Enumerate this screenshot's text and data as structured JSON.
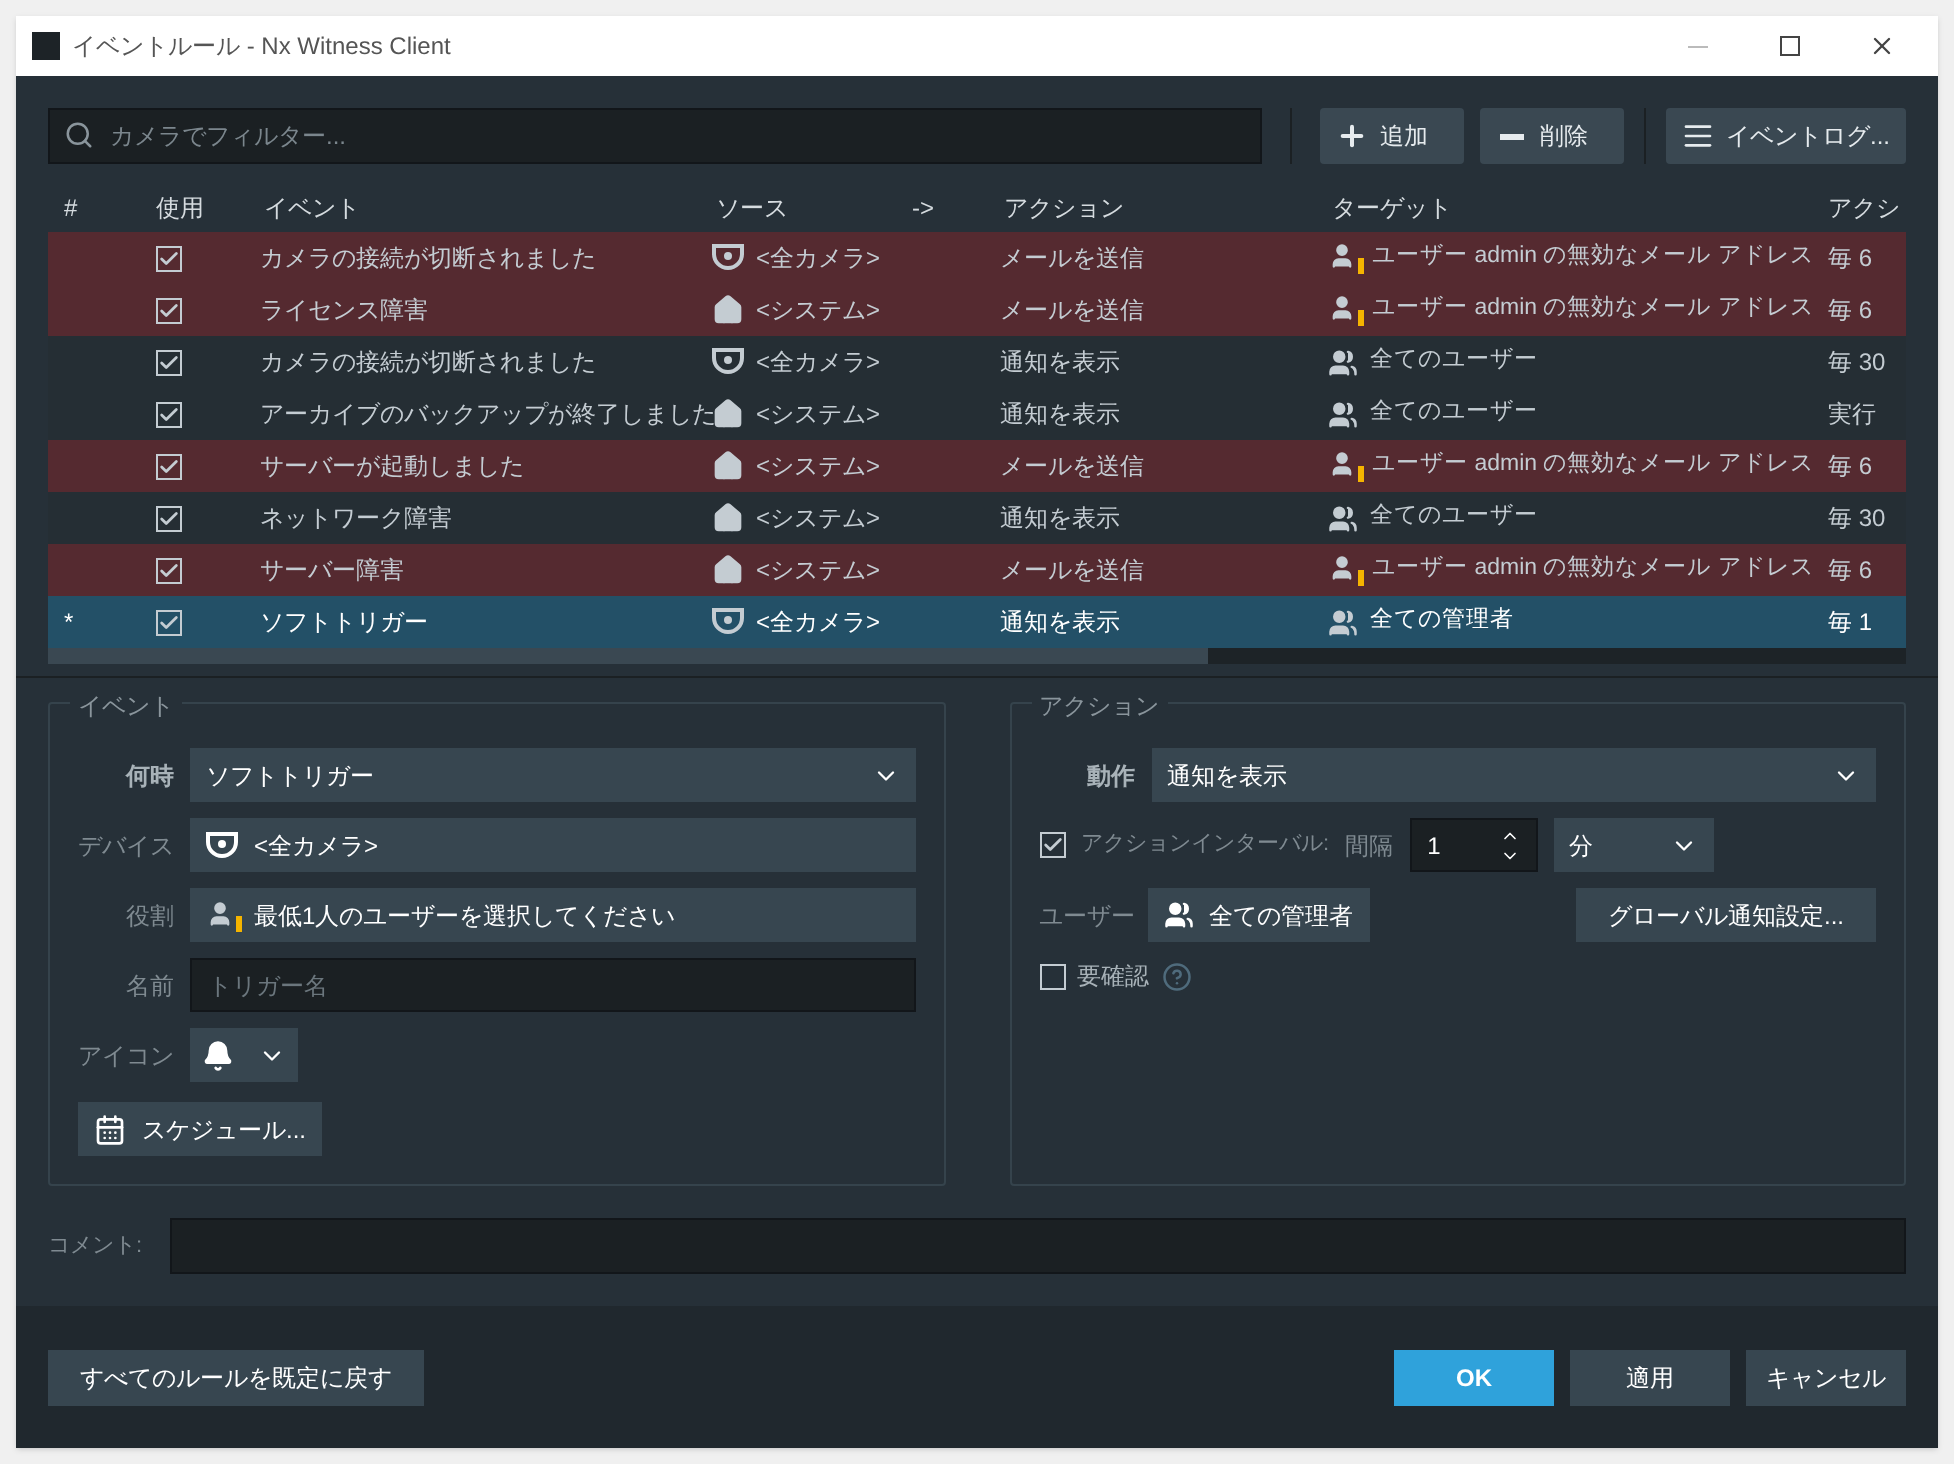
{
  "window": {
    "title": "イベントルール - Nx Witness Client"
  },
  "toolbar": {
    "search": {
      "placeholder": "カメラでフィルター..."
    },
    "buttons": [
      {
        "kind": "add",
        "label": "追加"
      },
      {
        "kind": "remove",
        "label": "削除"
      },
      {
        "kind": "log",
        "label": "イベントログ..."
      }
    ]
  },
  "table": {
    "columns": [
      "#",
      "使用",
      "イベント",
      "ソース",
      "->",
      "アクション",
      "ターゲット",
      "アクシ"
    ],
    "rows": [
      {
        "marker": "",
        "enabled": true,
        "invalid": true,
        "selected": false,
        "event": "カメラの接続が切断されました",
        "source": {
          "kind": "camera",
          "label": "<全カメラ>"
        },
        "action": "メールを送信",
        "target": {
          "kind": "user-warning",
          "label": "ユーザー admin の無効なメール アドレス"
        },
        "column_8": "毎 6"
      },
      {
        "marker": "",
        "enabled": true,
        "invalid": true,
        "selected": false,
        "event": "ライセンス障害",
        "source": {
          "kind": "system",
          "label": "<システム>"
        },
        "action": "メールを送信",
        "target": {
          "kind": "user-warning",
          "label": "ユーザー admin の無効なメール アドレス"
        },
        "column_8": "毎 6"
      },
      {
        "marker": "",
        "enabled": true,
        "invalid": false,
        "selected": false,
        "event": "カメラの接続が切断されました",
        "source": {
          "kind": "camera",
          "label": "<全カメラ>"
        },
        "action": "通知を表示",
        "target": {
          "kind": "users",
          "label": "全てのユーザー"
        },
        "column_8": "毎 30"
      },
      {
        "marker": "",
        "enabled": true,
        "invalid": false,
        "selected": false,
        "event": "アーカイブのバックアップが終了しました",
        "source": {
          "kind": "system",
          "label": "<システム>"
        },
        "action": "通知を表示",
        "target": {
          "kind": "users",
          "label": "全てのユーザー"
        },
        "column_8": "実行"
      },
      {
        "marker": "",
        "enabled": true,
        "invalid": true,
        "selected": false,
        "event": "サーバーが起動しました",
        "source": {
          "kind": "system",
          "label": "<システム>"
        },
        "action": "メールを送信",
        "target": {
          "kind": "user-warning",
          "label": "ユーザー admin の無効なメール アドレス"
        },
        "column_8": "毎 6"
      },
      {
        "marker": "",
        "enabled": true,
        "invalid": false,
        "selected": false,
        "event": "ネットワーク障害",
        "source": {
          "kind": "system",
          "label": "<システム>"
        },
        "action": "通知を表示",
        "target": {
          "kind": "users",
          "label": "全てのユーザー"
        },
        "column_8": "毎 30"
      },
      {
        "marker": "",
        "enabled": true,
        "invalid": true,
        "selected": false,
        "event": "サーバー障害",
        "source": {
          "kind": "system",
          "label": "<システム>"
        },
        "action": "メールを送信",
        "target": {
          "kind": "user-warning",
          "label": "ユーザー admin の無効なメール アドレス"
        },
        "column_8": "毎 6"
      },
      {
        "marker": "*",
        "enabled": true,
        "invalid": false,
        "selected": true,
        "event": "ソフトトリガー",
        "source": {
          "kind": "camera",
          "label": "<全カメラ>"
        },
        "action": "通知を表示",
        "target": {
          "kind": "users",
          "label": "全ての管理者"
        },
        "column_8": "毎 1"
      }
    ]
  },
  "event_panel": {
    "title": "イベント",
    "when": {
      "label": "何時",
      "value": "ソフトトリガー"
    },
    "device": {
      "label": "デバイス",
      "value": "<全カメラ>"
    },
    "role": {
      "label": "役割",
      "value": "最低1人のユーザーを選択してください"
    },
    "name": {
      "label": "名前",
      "placeholder": "トリガー名"
    },
    "icon": {
      "label": "アイコン"
    },
    "schedule_button": "スケジュール..."
  },
  "action_panel": {
    "title": "アクション",
    "operation": {
      "label": "動作",
      "value": "通知を表示"
    },
    "interval": {
      "checked": true,
      "label": "アクションインターバル:",
      "every_label": "間隔",
      "value": "1",
      "unit": "分"
    },
    "users": {
      "label": "ユーザー",
      "value": "全ての管理者"
    },
    "global_button": "グローバル通知設定...",
    "confirm": {
      "checked": false,
      "label": "要確認"
    }
  },
  "comment": {
    "label": "コメント:"
  },
  "footer": {
    "reset_button": "すべてのルールを既定に戻す",
    "buttons": [
      {
        "label": "OK",
        "primary": true
      },
      {
        "label": "適用",
        "primary": false
      },
      {
        "label": "キャンセル",
        "primary": false
      }
    ]
  }
}
